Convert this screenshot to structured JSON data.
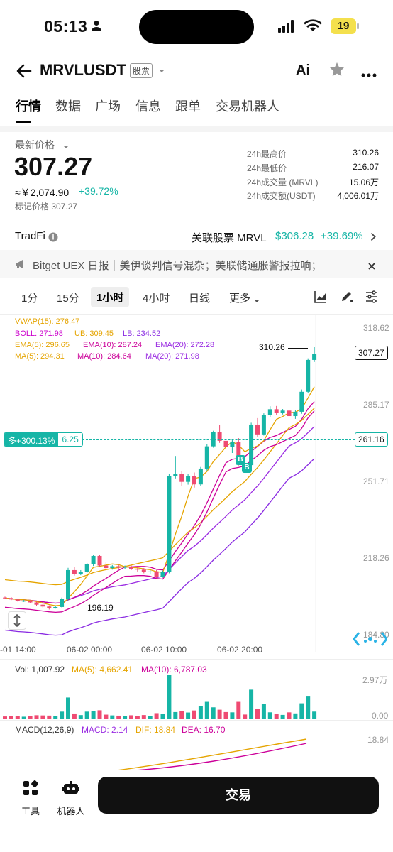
{
  "status_bar": {
    "time": "05:13",
    "battery": "19"
  },
  "header": {
    "symbol": "MRVLUSDT",
    "tag": "股票",
    "ai_label": "Ai"
  },
  "nav_tabs": [
    "行情",
    "数据",
    "广场",
    "信息",
    "跟单",
    "交易机器人"
  ],
  "price": {
    "label": "最新价格",
    "last": "307.27",
    "cny": "≈￥2,074.90",
    "change": "+39.72%",
    "mark": "标记价格 307.27"
  },
  "stats": [
    {
      "label": "24h最高价",
      "value": "310.26"
    },
    {
      "label": "24h最低价",
      "value": "216.07"
    },
    {
      "label": "24h成交量 (MRVL)",
      "value": "15.06万"
    },
    {
      "label": "24h成交额(USDT)",
      "value": "4,006.01万"
    }
  ],
  "tradfi": {
    "label": "TradFi",
    "related": "关联股票 MRVL",
    "price": "$306.28",
    "change": "+39.69%"
  },
  "news": {
    "text": "Bitget UEX 日报｜美伊谈判信号混杂；美联储通胀警报拉响；"
  },
  "intervals": [
    "1分",
    "15分",
    "1小时",
    "4小时",
    "日线",
    "更多"
  ],
  "active_interval": "1小时",
  "indicators": {
    "vwap": "VWAP(15): 276.47",
    "boll": "BOLL: 271.98",
    "ub": "UB: 309.45",
    "lb": "LB: 234.52",
    "ema5": "EMA(5): 296.65",
    "ema10": "EMA(10): 287.24",
    "ema20": "EMA(20): 272.28",
    "ma5": "MA(5): 294.31",
    "ma10": "MA(10): 284.64",
    "ma20": "MA(20): 271.98"
  },
  "price_axis": [
    "318.62",
    "285.17",
    "251.71",
    "218.26",
    "184.80"
  ],
  "current_price_tag": "307.27",
  "high_marker": "310.26",
  "low_marker": "196.19",
  "position_tag": {
    "label": "多+300.13%",
    "qty": "6.25",
    "price": "261.16"
  },
  "time_axis": [
    "-01 14:00",
    "06-02 00:00",
    "06-02 10:00",
    "06-02 20:00"
  ],
  "volume": {
    "vol": "Vol: 1,007.92",
    "ma5": "MA(5): 4,662.41",
    "ma10": "MA(10): 6,787.03",
    "axis_top": "2.97万",
    "axis_bottom": "0.00"
  },
  "macd": {
    "label": "MACD(12,26,9)",
    "macd": "MACD: 2.14",
    "dif": "DIF: 18.84",
    "dea": "DEA: 16.70",
    "axis_top": "18.84"
  },
  "bottom": {
    "tools": "工具",
    "robot": "机器人",
    "trade": "交易"
  },
  "colors": {
    "up": "#16b5a6",
    "down": "#ef4a72",
    "accent": "#16b5a6"
  },
  "chart_data": {
    "type": "candlestick",
    "ylim": [
      184.8,
      318.62
    ],
    "series": [
      {
        "name": "candles",
        "ohlc": [
          [
            201.0,
            201.4,
            200.4,
            200.8
          ],
          [
            200.8,
            201.2,
            199.9,
            200.2
          ],
          [
            200.2,
            200.6,
            199.3,
            199.6
          ],
          [
            199.6,
            200.0,
            199.1,
            199.6
          ],
          [
            199.6,
            200.0,
            198.5,
            198.9
          ],
          [
            198.9,
            199.3,
            197.4,
            197.9
          ],
          [
            197.9,
            198.4,
            196.5,
            197.1
          ],
          [
            197.1,
            197.6,
            195.8,
            196.4
          ],
          [
            196.4,
            197.2,
            196.19,
            196.9
          ],
          [
            196.9,
            201.0,
            196.7,
            200.3
          ],
          [
            200.3,
            214.0,
            199.8,
            213.0
          ],
          [
            213.0,
            214.5,
            210.6,
            211.2
          ],
          [
            211.2,
            213.0,
            210.8,
            212.2
          ],
          [
            212.2,
            216.1,
            211.8,
            215.6
          ],
          [
            215.6,
            219.8,
            214.8,
            219.2
          ],
          [
            219.2,
            219.8,
            214.3,
            215.0
          ],
          [
            215.0,
            216.4,
            213.4,
            213.9
          ],
          [
            213.9,
            215.2,
            213.2,
            214.7
          ],
          [
            214.7,
            215.4,
            213.5,
            214.1
          ],
          [
            214.1,
            215.0,
            213.5,
            214.5
          ],
          [
            214.5,
            215.0,
            213.0,
            213.6
          ],
          [
            213.6,
            214.2,
            212.4,
            213.2
          ],
          [
            213.2,
            213.9,
            211.6,
            212.2
          ],
          [
            212.2,
            213.0,
            211.4,
            212.4
          ],
          [
            212.4,
            213.0,
            209.5,
            210.1
          ],
          [
            210.1,
            212.8,
            209.7,
            212.1
          ],
          [
            212.1,
            255.0,
            211.6,
            254.0
          ],
          [
            254.0,
            262.8,
            253.0,
            254.8
          ],
          [
            254.8,
            256.2,
            249.8,
            251.5
          ],
          [
            251.5,
            254.8,
            250.3,
            254.0
          ],
          [
            254.0,
            255.6,
            249.0,
            250.4
          ],
          [
            250.4,
            258.0,
            249.8,
            257.3
          ],
          [
            257.3,
            267.9,
            256.4,
            267.0
          ],
          [
            267.0,
            273.8,
            266.4,
            273.2
          ],
          [
            273.2,
            276.3,
            268.5,
            269.4
          ],
          [
            269.4,
            271.3,
            266.0,
            266.8
          ],
          [
            266.8,
            270.0,
            264.1,
            268.9
          ],
          [
            268.9,
            270.6,
            258.6,
            259.4
          ],
          [
            259.4,
            262.0,
            257.5,
            258.8
          ],
          [
            258.8,
            277.3,
            257.2,
            276.5
          ],
          [
            276.5,
            279.3,
            271.1,
            272.2
          ],
          [
            272.2,
            281.4,
            271.7,
            280.6
          ],
          [
            280.6,
            284.5,
            279.8,
            283.2
          ],
          [
            283.2,
            284.6,
            280.6,
            281.5
          ],
          [
            281.5,
            283.3,
            280.9,
            282.6
          ],
          [
            282.6,
            284.5,
            279.4,
            280.2
          ],
          [
            280.2,
            282.9,
            279.0,
            282.1
          ],
          [
            282.1,
            291.8,
            281.2,
            290.8
          ],
          [
            290.8,
            305.4,
            290.3,
            304.7
          ],
          [
            304.7,
            310.26,
            303.8,
            307.27
          ]
        ]
      }
    ]
  }
}
